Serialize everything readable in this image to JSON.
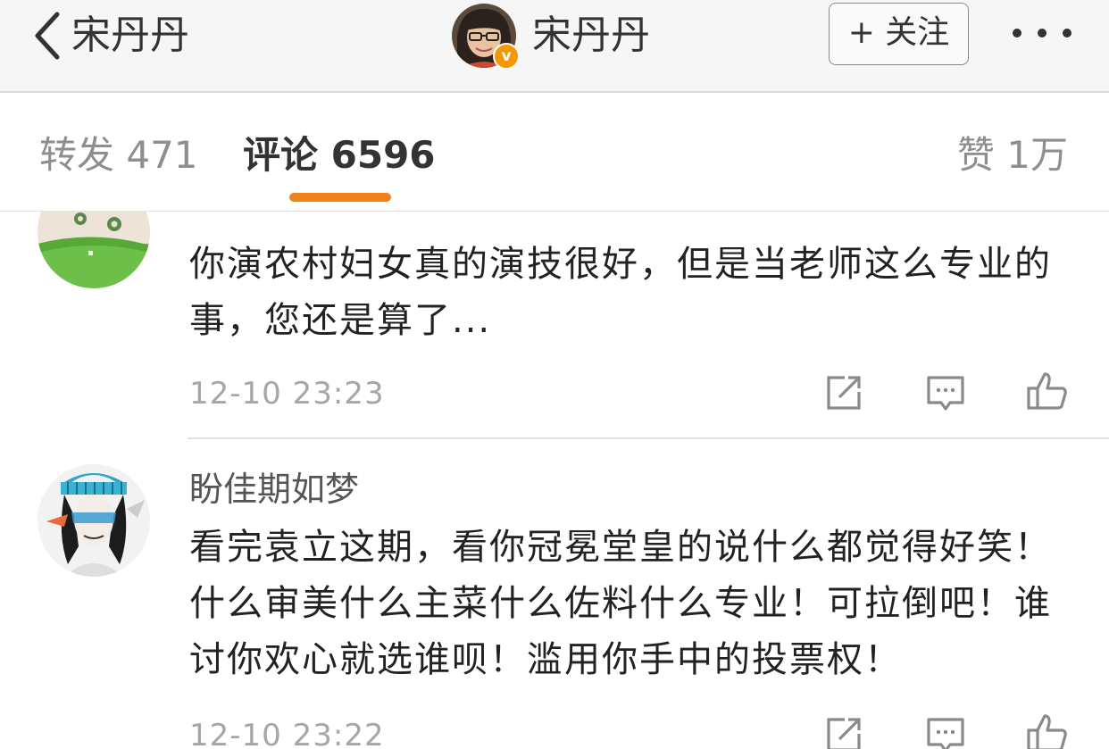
{
  "nav": {
    "title": "宋丹丹",
    "center_title": "宋丹丹",
    "follow_label": "+ 关注",
    "icons": [
      "back-chevron-icon",
      "verified-v-icon",
      "more-dots-icon"
    ]
  },
  "tabs": {
    "repost": "转发 471",
    "comments": "评论 6596",
    "likes": "赞 1万",
    "active_color": "#f0801a"
  },
  "comments": [
    {
      "username": "",
      "text": "你演农村妇女真的演技很好，但是当老师这么专业的事，您还是算了...",
      "time": "12-10 23:23"
    },
    {
      "username": "盼佳期如梦",
      "text": "看完袁立这期，看你冠冕堂皇的说什么都觉得好笑！什么审美什么主菜什么佐料什么专业！可拉倒吧！谁讨你欢心就选谁呗！滥用你手中的投票权！",
      "time": "12-10 23:22"
    }
  ],
  "action_icons": [
    "repost-icon",
    "comment-icon",
    "like-icon"
  ]
}
